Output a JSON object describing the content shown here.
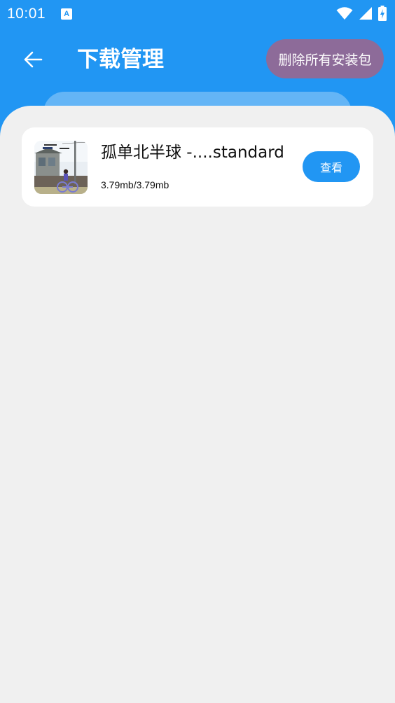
{
  "status_bar": {
    "time": "10:01",
    "notification_icon_letter": "A",
    "icons": [
      "wifi-icon",
      "signal-icon",
      "battery-charging-icon"
    ]
  },
  "toolbar": {
    "back_icon": "arrow-left-icon",
    "title": "下载管理",
    "delete_all_label": "删除所有安装包"
  },
  "downloads": [
    {
      "name": "孤单北半球 -....standard",
      "size": "3.79mb/3.79mb",
      "action_label": "查看"
    }
  ],
  "colors": {
    "header_blue": "#2196f3",
    "delete_button": "#8d6b99",
    "background": "#f0f0f0"
  }
}
